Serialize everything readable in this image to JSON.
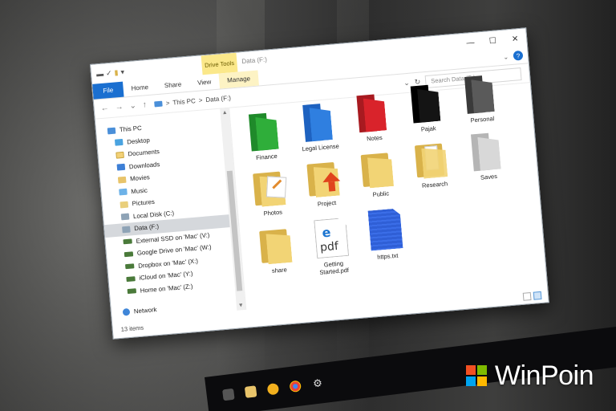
{
  "window": {
    "title": "Data (F:)",
    "context_tab": "Drive Tools",
    "ribbon_tabs": {
      "file": "File",
      "home": "Home",
      "share": "Share",
      "view": "View",
      "manage": "Manage"
    },
    "caption": {
      "minimize": "—",
      "maximize": "☐",
      "close": "✕"
    }
  },
  "address_bar": {
    "path": [
      "This PC",
      "Data (F:)"
    ],
    "separator": ">",
    "search_placeholder": "Search Data (F:)"
  },
  "sidebar": {
    "items": [
      {
        "label": "This PC",
        "icon": "pc-icon",
        "level": 0
      },
      {
        "label": "Desktop",
        "icon": "desktop-icon",
        "level": 1
      },
      {
        "label": "Documents",
        "icon": "documents-icon",
        "level": 1
      },
      {
        "label": "Downloads",
        "icon": "downloads-icon",
        "level": 1
      },
      {
        "label": "Movies",
        "icon": "movies-icon",
        "level": 1
      },
      {
        "label": "Music",
        "icon": "music-icon",
        "level": 1
      },
      {
        "label": "Pictures",
        "icon": "pictures-icon",
        "level": 1
      },
      {
        "label": "Local Disk (C:)",
        "icon": "disk-icon",
        "level": 1
      },
      {
        "label": "Data (F:)",
        "icon": "disk-icon",
        "level": 1,
        "selected": true
      },
      {
        "label": "External SSD on 'Mac' (V:)",
        "icon": "network-drive-icon",
        "level": 1
      },
      {
        "label": "Google Drive on 'Mac' (W:)",
        "icon": "network-drive-icon",
        "level": 1
      },
      {
        "label": "Dropbox on 'Mac' (X:)",
        "icon": "network-drive-icon",
        "level": 1
      },
      {
        "label": "iCloud on 'Mac' (Y:)",
        "icon": "network-drive-icon",
        "level": 1
      },
      {
        "label": "Home on 'Mac' (Z:)",
        "icon": "network-drive-icon",
        "level": 1
      },
      {
        "label": "Network",
        "icon": "network-icon",
        "level": 0
      }
    ]
  },
  "files": [
    {
      "label": "Finance",
      "kind": "colored-folder",
      "color": "#2fae3a"
    },
    {
      "label": "Legal License",
      "kind": "colored-folder",
      "color": "#2f7fe0"
    },
    {
      "label": "Notes",
      "kind": "colored-folder",
      "color": "#d9232b"
    },
    {
      "label": "Pajak",
      "kind": "colored-folder",
      "color": "#141414"
    },
    {
      "label": "Personal",
      "kind": "colored-folder",
      "color": "#5a5a5a"
    },
    {
      "label": "Photos",
      "kind": "folder-with-picture"
    },
    {
      "label": "Project",
      "kind": "folder-with-arrow"
    },
    {
      "label": "Public",
      "kind": "folder"
    },
    {
      "label": "Research",
      "kind": "folder-with-docs"
    },
    {
      "label": "Saves",
      "kind": "colored-folder",
      "color": "#cfcfcf"
    },
    {
      "label": "share",
      "kind": "folder"
    },
    {
      "label": "Getting Started.pdf",
      "kind": "pdf"
    },
    {
      "label": "https.txt",
      "kind": "txt"
    }
  ],
  "status": {
    "item_count": "13 items"
  },
  "branding": {
    "name": "WinPoin"
  },
  "colors": {
    "accent": "#1a6fd0",
    "context_tab": "#fbe88a"
  }
}
